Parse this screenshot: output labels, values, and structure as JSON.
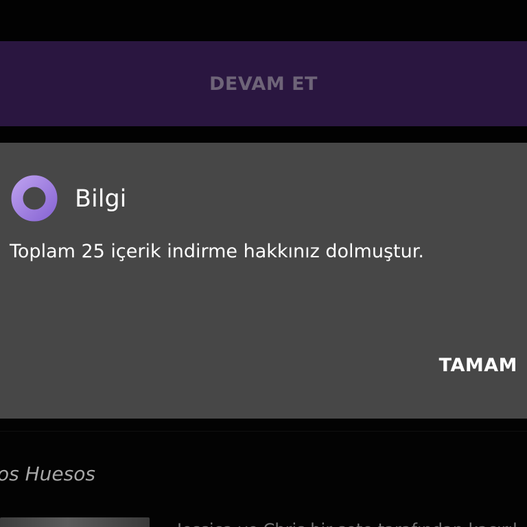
{
  "top_action": {
    "label": "DEVAM ET"
  },
  "dialog": {
    "icon": "info-icon",
    "title": "Bilgi",
    "message": "Toplam 25 içerik indirme hakkınız dolmuştur.",
    "confirm_label": "TAMAM"
  },
  "background": {
    "section_title": "os Huesos",
    "description_peek": "Jessica ve Chris bir sete tarafından kaçırıl"
  },
  "colors": {
    "continue_bar": "#2a1640",
    "dialog_background": "#474747",
    "icon_accent": "#a887e0"
  }
}
